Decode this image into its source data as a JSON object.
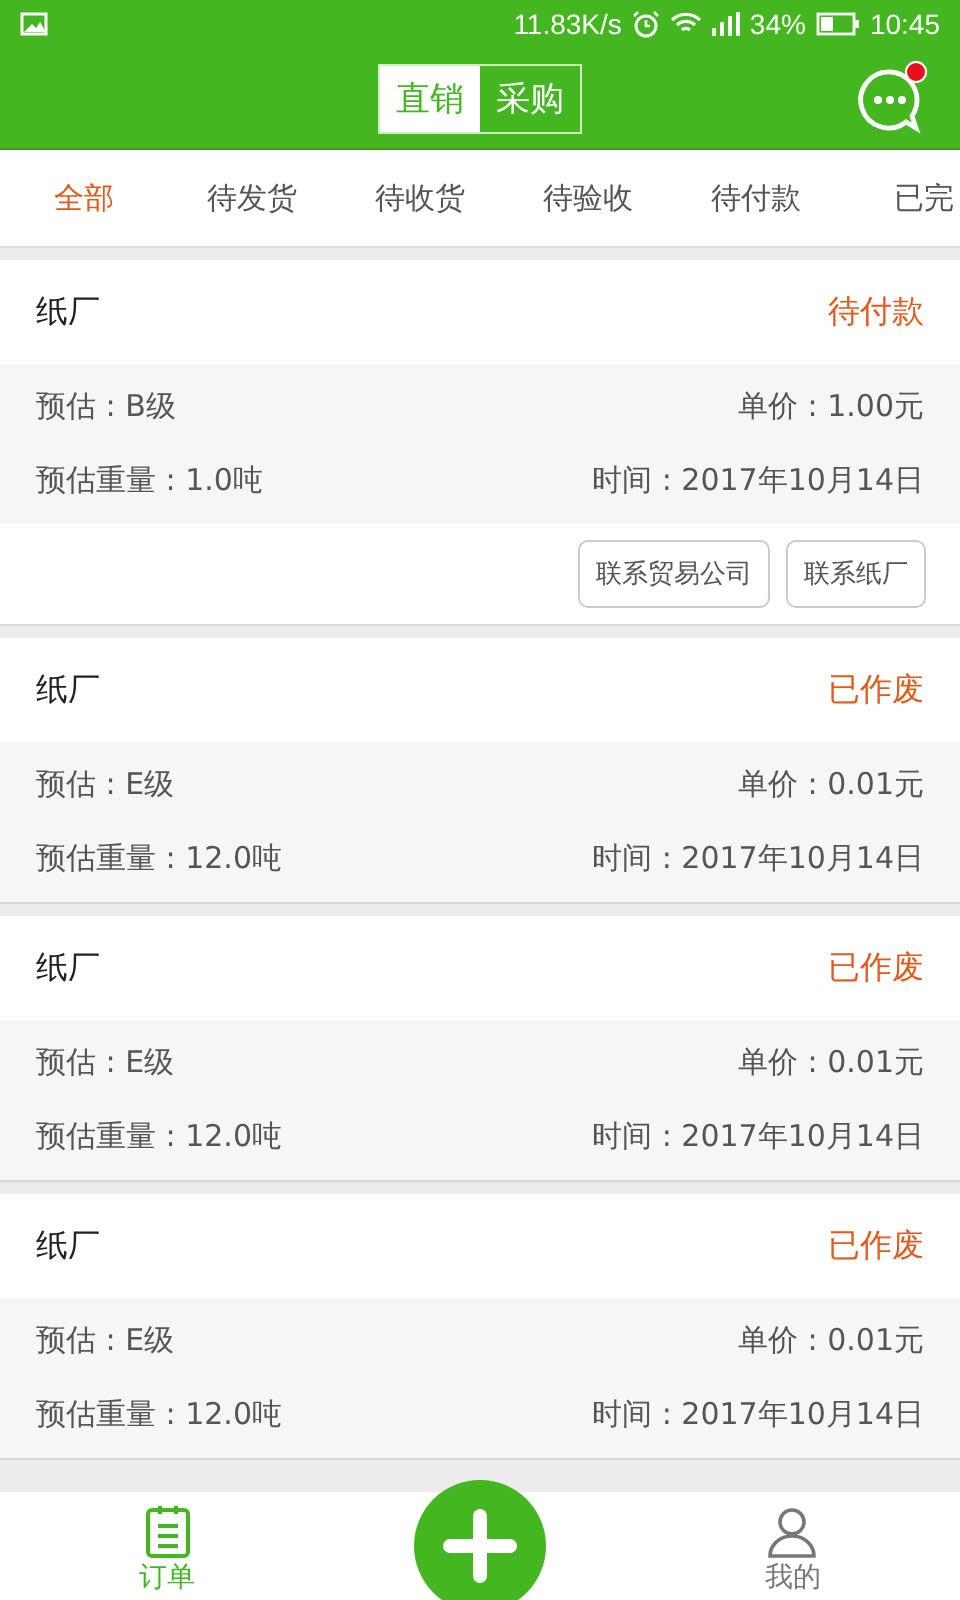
{
  "status_bar": {
    "speed": "11.83K/s",
    "battery": "34%",
    "time": "10:45"
  },
  "header": {
    "segments": [
      {
        "label": "直销",
        "selected": true
      },
      {
        "label": "采购",
        "selected": false
      }
    ],
    "message_unread": true
  },
  "tabs": [
    {
      "label": "全部",
      "selected": true
    },
    {
      "label": "待发货",
      "selected": false
    },
    {
      "label": "待收货",
      "selected": false
    },
    {
      "label": "待验收",
      "selected": false
    },
    {
      "label": "待付款",
      "selected": false
    },
    {
      "label": "已完",
      "selected": false
    }
  ],
  "orders": [
    {
      "name": "纸厂",
      "status": "待付款",
      "grade": "预估 : B级",
      "price": "单价 : 1.00元",
      "weight": "预估重量 : 1.0吨",
      "date": "时间 : 2017年10月14日",
      "actions": [
        "联系贸易公司",
        "联系纸厂"
      ]
    },
    {
      "name": "纸厂",
      "status": "已作废",
      "grade": "预估 : E级",
      "price": "单价 : 0.01元",
      "weight": "预估重量 : 12.0吨",
      "date": "时间 : 2017年10月14日"
    },
    {
      "name": "纸厂",
      "status": "已作废",
      "grade": "预估 : E级",
      "price": "单价 : 0.01元",
      "weight": "预估重量 : 12.0吨",
      "date": "时间 : 2017年10月14日"
    },
    {
      "name": "纸厂",
      "status": "已作废",
      "grade": "预估 : E级",
      "price": "单价 : 0.01元",
      "weight": "预估重量 : 12.0吨",
      "date": "时间 : 2017年10月14日"
    }
  ],
  "bottom_nav": [
    {
      "kind": "orders",
      "label": "订单",
      "selected": true
    },
    {
      "kind": "add"
    },
    {
      "kind": "profile",
      "label": "我的",
      "selected": false
    }
  ]
}
